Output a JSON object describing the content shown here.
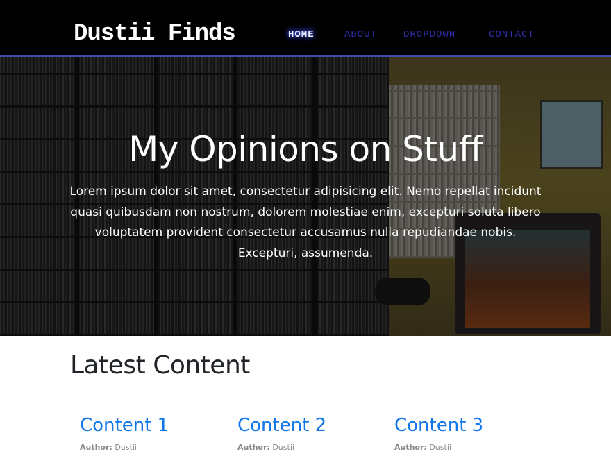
{
  "navbar": {
    "brand": "Dustii Finds",
    "links": [
      {
        "label": "Home",
        "active": true
      },
      {
        "label": "About",
        "active": false
      },
      {
        "label": "Dropdown",
        "active": false
      },
      {
        "label": "Contact",
        "active": false
      }
    ]
  },
  "hero": {
    "title": "My Opinions on Stuff",
    "text": "Lorem ipsum dolor sit amet, consectetur adipisicing elit. Nemo repellat incidunt quasi quibusdam non nostrum, dolorem molestiae enim, excepturi soluta libero voluptatem provident consectetur accusamus nulla repudiandae nobis. Excepturi, assumenda."
  },
  "main": {
    "section_title": "Latest Content",
    "cards": [
      {
        "title": "Content 1",
        "author_label": "Author:",
        "author": "Dustii"
      },
      {
        "title": "Content 2",
        "author_label": "Author:",
        "author": "Dustii"
      },
      {
        "title": "Content 3",
        "author_label": "Author:",
        "author": "Dustii"
      }
    ]
  },
  "colors": {
    "nav_background": "#000000",
    "nav_border": "#3f4bb0",
    "nav_link": "#2d2ea5",
    "link_blue": "#1177e8",
    "heading": "#212529"
  }
}
